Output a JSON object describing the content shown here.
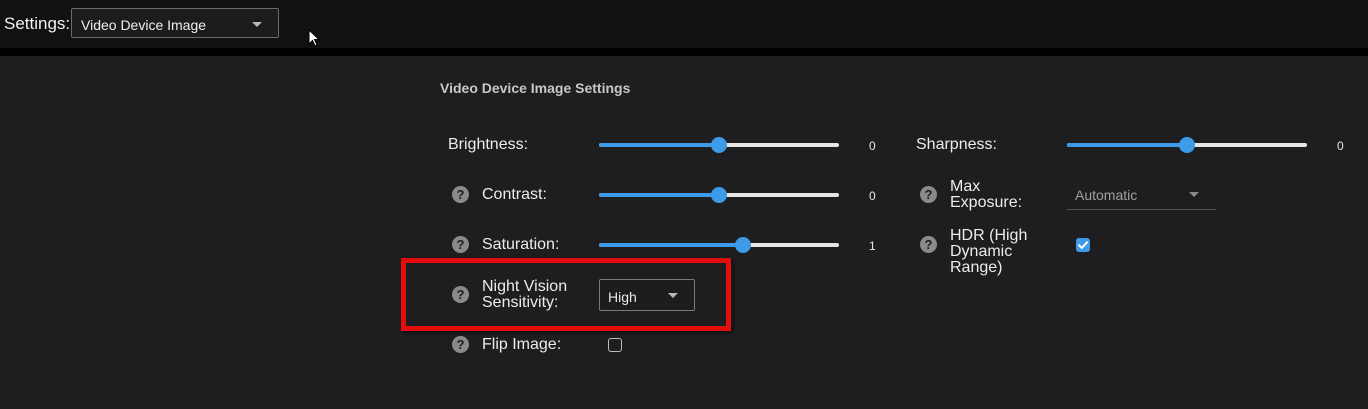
{
  "header": {
    "settings_label": "Settings:",
    "settings_select_value": "Video Device Image"
  },
  "section": {
    "title": "Video Device Image Settings"
  },
  "left_controls": {
    "brightness": {
      "label": "Brightness:",
      "value": "0",
      "level": 0.5
    },
    "contrast": {
      "label": "Contrast:",
      "value": "0",
      "level": 0.5
    },
    "saturation": {
      "label": "Saturation:",
      "value": "1",
      "level": 0.6
    },
    "night_vision": {
      "label_line1": "Night Vision",
      "label_line2": "Sensitivity:",
      "value": "High"
    },
    "flip_image": {
      "label": "Flip Image:",
      "checked": false
    }
  },
  "right_controls": {
    "sharpness": {
      "label": "Sharpness:",
      "value": "0",
      "level": 0.5
    },
    "max_exposure": {
      "label_line1": "Max",
      "label_line2": "Exposure:",
      "value": "Automatic"
    },
    "hdr": {
      "label_line1": "HDR (High",
      "label_line2": "Dynamic",
      "label_line3": "Range)",
      "checked": true
    }
  },
  "icons": {
    "help": "?",
    "checkmark": "check-icon",
    "dropdown": "chevron-down-icon",
    "cursor": "mouse-pointer-icon"
  },
  "colors": {
    "accent": "#3d9be9",
    "highlight": "#e30d0d",
    "background": "#1e1d20",
    "topbar": "#111111"
  }
}
